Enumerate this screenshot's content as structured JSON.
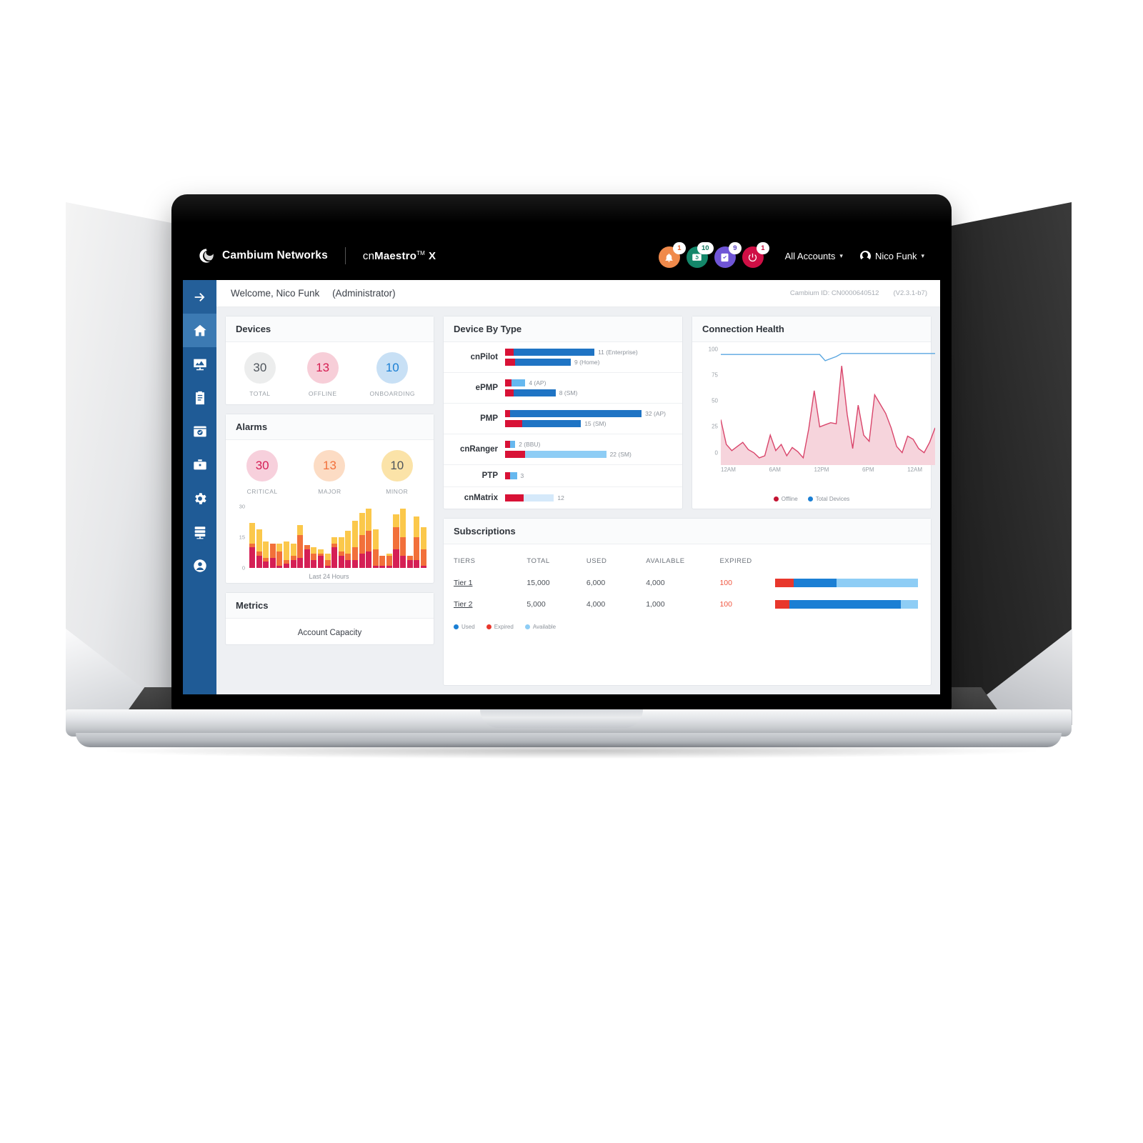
{
  "topbar": {
    "brand": "Cambium Networks",
    "product_prefix": "cn",
    "product_name": "Maestro",
    "product_tm": "TM",
    "product_x": "X",
    "badges": [
      {
        "name": "alarm-bell",
        "count": "1",
        "color": "#f08a4b"
      },
      {
        "name": "monitor-refresh",
        "count": "10",
        "color": "#14876a"
      },
      {
        "name": "task-check",
        "count": "9",
        "color": "#6f55d6"
      },
      {
        "name": "power-reboot",
        "count": "1",
        "color": "#cf0f45"
      }
    ],
    "account_selector": "All Accounts",
    "user_name": "Nico Funk"
  },
  "welcome": {
    "greeting": "Welcome, Nico Funk",
    "role": "(Administrator)",
    "cambium_id_label": "Cambium ID:",
    "cambium_id_value": "CN0000640512",
    "version": "(V2.3.1-b7)"
  },
  "sidebar": {
    "items": [
      {
        "name": "expand-arrow-icon",
        "label": "Expand"
      },
      {
        "name": "home-icon",
        "label": "Home"
      },
      {
        "name": "monitor-report-icon",
        "label": "Monitor"
      },
      {
        "name": "clipboard-icon",
        "label": "Inventory"
      },
      {
        "name": "window-check-icon",
        "label": "Onboarding"
      },
      {
        "name": "toolbox-icon",
        "label": "Tools"
      },
      {
        "name": "gear-icon",
        "label": "Administration"
      },
      {
        "name": "server-rack-icon",
        "label": "Network"
      },
      {
        "name": "user-circle-icon",
        "label": "Account"
      }
    ]
  },
  "devices_card": {
    "title": "Devices",
    "stats": [
      {
        "value": "30",
        "label": "TOTAL",
        "bg": "#eceded",
        "fg": "#4f555c"
      },
      {
        "value": "13",
        "label": "OFFLINE",
        "bg": "#f7ced8",
        "fg": "#d61f53"
      },
      {
        "value": "10",
        "label": "ONBOARDING",
        "bg": "#c8e0f5",
        "fg": "#1b7fd4"
      }
    ]
  },
  "alarms_card": {
    "title": "Alarms",
    "stats": [
      {
        "value": "30",
        "label": "CRITICAL",
        "bg": "#f7d0dc",
        "fg": "#d51f55"
      },
      {
        "value": "13",
        "label": "MAJOR",
        "bg": "#fcdcc4",
        "fg": "#f2703a"
      },
      {
        "value": "10",
        "label": "MINOR",
        "bg": "#fbe3a8",
        "fg": "#4f555c"
      }
    ],
    "caption": "Last 24 Hours"
  },
  "metrics_card": {
    "title": "Metrics",
    "subtitle": "Account Capacity"
  },
  "device_by_type": {
    "title": "Device By Type",
    "rows": [
      {
        "label": "cnPilot",
        "bars": [
          {
            "value": "11",
            "suffix": "(Enterprise)",
            "red_pct": 5,
            "blue_pct": 48,
            "blue_color": "#1f74c4"
          },
          {
            "value": "9",
            "suffix": "(Home)",
            "red_pct": 6,
            "blue_pct": 33,
            "blue_color": "#1f74c4"
          }
        ]
      },
      {
        "label": "ePMP",
        "bars": [
          {
            "value": "4",
            "suffix": "(AP)",
            "red_pct": 4,
            "blue_pct": 8,
            "blue_color": "#66b8ef"
          },
          {
            "value": "8",
            "suffix": "(SM)",
            "red_pct": 5,
            "blue_pct": 25,
            "blue_color": "#1f74c4"
          }
        ]
      },
      {
        "label": "PMP",
        "bars": [
          {
            "value": "32",
            "suffix": "(AP)",
            "red_pct": 3,
            "blue_pct": 78,
            "blue_color": "#1f74c4"
          },
          {
            "value": "15",
            "suffix": "(SM)",
            "red_pct": 10,
            "blue_pct": 35,
            "blue_color": "#1f74c4"
          }
        ]
      },
      {
        "label": "cnRanger",
        "bars": [
          {
            "value": "2",
            "suffix": "(BBU)",
            "red_pct": 3,
            "blue_pct": 3,
            "blue_color": "#66b8ef"
          },
          {
            "value": "22",
            "suffix": "(SM)",
            "red_pct": 12,
            "blue_pct": 48,
            "blue_color": "#8ecdf5"
          }
        ]
      },
      {
        "label": "PTP",
        "bars": [
          {
            "value": "3",
            "suffix": "",
            "red_pct": 3,
            "blue_pct": 4,
            "blue_color": "#66b8ef"
          }
        ]
      },
      {
        "label": "cnMatrix",
        "bars": [
          {
            "value": "12",
            "suffix": "",
            "red_pct": 11,
            "blue_pct": 18,
            "blue_color": "#d5e9fa"
          }
        ]
      }
    ],
    "red_color": "#d81236"
  },
  "connection_health": {
    "title": "Connection Health",
    "legend": [
      {
        "label": "Offline",
        "color": "#c31432"
      },
      {
        "label": "Total Devices",
        "color": "#1b7fd4"
      }
    ]
  },
  "subscriptions": {
    "title": "Subscriptions",
    "columns": [
      "TIERS",
      "TOTAL",
      "USED",
      "AVAILABLE",
      "EXPIRED"
    ],
    "rows": [
      {
        "tier": "Tier 1",
        "total": "15,000",
        "used": "6,000",
        "available": "4,000",
        "expired": "100",
        "expired_pct": 13,
        "used_pct": 30,
        "available_pct": 57
      },
      {
        "tier": "Tier 2",
        "total": "5,000",
        "used": "4,000",
        "available": "1,000",
        "expired": "100",
        "expired_pct": 10,
        "used_pct": 78,
        "available_pct": 12
      }
    ],
    "legend": [
      {
        "label": "Used",
        "color": "#1b7fd4"
      },
      {
        "label": "Expired",
        "color": "#e8372c"
      },
      {
        "label": "Available",
        "color": "#8ecdf5"
      }
    ]
  },
  "chart_data": [
    {
      "type": "bar",
      "title": "Alarms — Last 24 Hours",
      "xlabel": "Last 24 Hours",
      "ylabel": "",
      "ylim": [
        0,
        30
      ],
      "yticks": [
        0,
        15,
        30
      ],
      "stacked": true,
      "series": [
        {
          "name": "Critical",
          "color": "#d51f55",
          "values": [
            10,
            6,
            3,
            5,
            1,
            2,
            4,
            5,
            9,
            4,
            6,
            1,
            10,
            6,
            4,
            4,
            7,
            8,
            1,
            1,
            1,
            9,
            6,
            4,
            4,
            1
          ]
        },
        {
          "name": "Major",
          "color": "#f2703a",
          "values": [
            2,
            2,
            2,
            7,
            7,
            2,
            2,
            11,
            2,
            3,
            1,
            3,
            2,
            2,
            3,
            6,
            9,
            10,
            8,
            5,
            5,
            11,
            9,
            2,
            11,
            8
          ]
        },
        {
          "name": "Minor",
          "color": "#fbc84b",
          "values": [
            10,
            11,
            8,
            0,
            4,
            9,
            6,
            5,
            0,
            3,
            2,
            3,
            3,
            7,
            11,
            13,
            11,
            11,
            10,
            0,
            1,
            6,
            14,
            0,
            10,
            11
          ]
        }
      ]
    },
    {
      "type": "area",
      "title": "Connection Health",
      "xlabel": "",
      "ylabel": "",
      "ylim": [
        0,
        100
      ],
      "yticks": [
        0,
        25,
        50,
        75,
        100
      ],
      "xticks": [
        "12AM",
        "6AM",
        "12PM",
        "6PM",
        "12AM"
      ],
      "series": [
        {
          "name": "Total Devices",
          "color": "#5aa6e0",
          "type": "line",
          "values": [
            95,
            95,
            95,
            95,
            95,
            95,
            95,
            95,
            95,
            95,
            95,
            95,
            95,
            95,
            95,
            95,
            95,
            95,
            95,
            89,
            91,
            93,
            96,
            96,
            96,
            96,
            96,
            96,
            96,
            96,
            96,
            96,
            96,
            96,
            96,
            96,
            96,
            96,
            96,
            96
          ]
        },
        {
          "name": "Offline",
          "color": "#d9456b",
          "fill": "#f6d4dc",
          "type": "area",
          "values": [
            32,
            8,
            2,
            6,
            10,
            3,
            0,
            -5,
            -3,
            17,
            2,
            8,
            -3,
            5,
            1,
            -5,
            23,
            60,
            25,
            27,
            29,
            28,
            84,
            37,
            4,
            46,
            17,
            11,
            56,
            47,
            38,
            24,
            6,
            0,
            16,
            13,
            4,
            0,
            10,
            24
          ]
        }
      ]
    },
    {
      "type": "bar",
      "title": "Device By Type",
      "orientation": "horizontal",
      "categories": [
        "cnPilot (Enterprise)",
        "cnPilot (Home)",
        "ePMP (AP)",
        "ePMP (SM)",
        "PMP (AP)",
        "PMP (SM)",
        "cnRanger (BBU)",
        "cnRanger (SM)",
        "PTP",
        "cnMatrix"
      ],
      "values": [
        11,
        9,
        4,
        8,
        32,
        15,
        2,
        22,
        3,
        12
      ]
    },
    {
      "type": "bar",
      "title": "Subscriptions",
      "orientation": "horizontal",
      "stacked": true,
      "categories": [
        "Tier 1",
        "Tier 2"
      ],
      "series": [
        {
          "name": "Expired",
          "color": "#e8372c",
          "values": [
            100,
            100
          ]
        },
        {
          "name": "Used",
          "color": "#1b7fd4",
          "values": [
            6000,
            4000
          ]
        },
        {
          "name": "Available",
          "color": "#8ecdf5",
          "values": [
            4000,
            1000
          ]
        }
      ]
    }
  ]
}
